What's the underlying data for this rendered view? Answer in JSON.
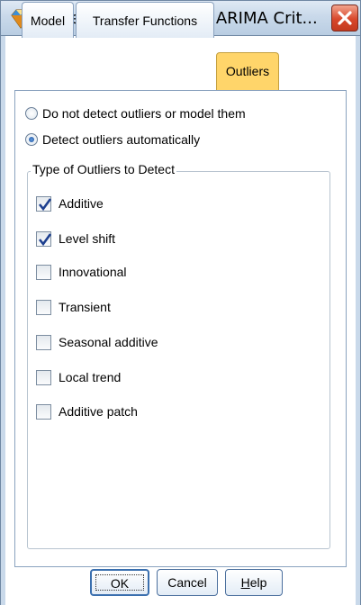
{
  "window": {
    "title": "Time Series Modeler: ARIMA Crit...",
    "close_icon": "close-icon",
    "app_icon": "diamond-app-icon"
  },
  "tabs": [
    {
      "label": "Model",
      "active": false
    },
    {
      "label": "Transfer Functions",
      "active": false
    },
    {
      "label": "Outliers",
      "active": true
    }
  ],
  "detection": {
    "options": [
      {
        "label": "Do not detect outliers or model them",
        "selected": false
      },
      {
        "label": "Detect outliers automatically",
        "selected": true
      }
    ]
  },
  "outlier_types": {
    "legend": "Type of Outliers to Detect",
    "items": [
      {
        "label": "Additive",
        "checked": true
      },
      {
        "label": "Level shift",
        "checked": true
      },
      {
        "label": "Innovational",
        "checked": false
      },
      {
        "label": "Transient",
        "checked": false
      },
      {
        "label": "Seasonal additive",
        "checked": false
      },
      {
        "label": "Local trend",
        "checked": false
      },
      {
        "label": "Additive patch",
        "checked": false
      }
    ]
  },
  "footer": {
    "ok_label": "OK",
    "cancel_label": "Cancel",
    "help_label_prefix": "",
    "help_mnemonic": "H",
    "help_label_rest": "elp"
  },
  "colors": {
    "active_tab": "#ffd56a",
    "close_button": "#d8472b",
    "check_mark": "#1d3f8f"
  }
}
